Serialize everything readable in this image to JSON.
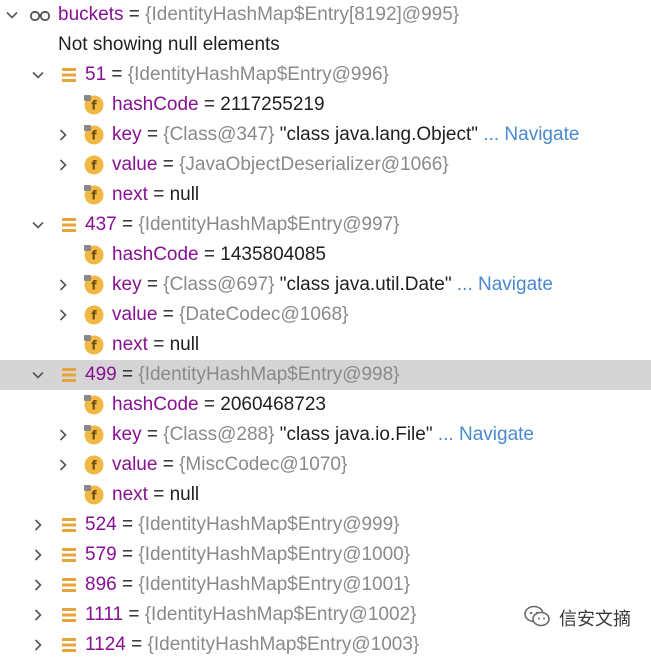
{
  "tree": {
    "root": {
      "name": "buckets",
      "eq": " = ",
      "value": "{IdentityHashMap$Entry[8192]@995}",
      "icon": "glasses-icon"
    },
    "notice": "Not showing null elements",
    "entries": [
      {
        "index": "51",
        "value": "{IdentityHashMap$Entry@996}",
        "fields": [
          {
            "name": "hashCode",
            "plain": "2117255219",
            "gray": "",
            "str": "",
            "nav": ""
          },
          {
            "name": "key",
            "plain": "",
            "gray": "{Class@347}",
            "str": "\"class java.lang.Object\"",
            "nav": "... Navigate"
          },
          {
            "name": "value",
            "plain": "",
            "gray": "{JavaObjectDeserializer@1066}",
            "str": "",
            "nav": ""
          },
          {
            "name": "next",
            "plain": "null",
            "gray": "",
            "str": "",
            "nav": ""
          }
        ]
      },
      {
        "index": "437",
        "value": "{IdentityHashMap$Entry@997}",
        "fields": [
          {
            "name": "hashCode",
            "plain": "1435804085",
            "gray": "",
            "str": "",
            "nav": ""
          },
          {
            "name": "key",
            "plain": "",
            "gray": "{Class@697}",
            "str": "\"class java.util.Date\"",
            "nav": "... Navigate"
          },
          {
            "name": "value",
            "plain": "",
            "gray": "{DateCodec@1068}",
            "str": "",
            "nav": ""
          },
          {
            "name": "next",
            "plain": "null",
            "gray": "",
            "str": "",
            "nav": ""
          }
        ]
      },
      {
        "index": "499",
        "value": "{IdentityHashMap$Entry@998}",
        "fields": [
          {
            "name": "hashCode",
            "plain": "2060468723",
            "gray": "",
            "str": "",
            "nav": ""
          },
          {
            "name": "key",
            "plain": "",
            "gray": "{Class@288}",
            "str": "\"class java.io.File\"",
            "nav": "... Navigate"
          },
          {
            "name": "value",
            "plain": "",
            "gray": "{MiscCodec@1070}",
            "str": "",
            "nav": ""
          },
          {
            "name": "next",
            "plain": "null",
            "gray": "",
            "str": "",
            "nav": ""
          }
        ]
      }
    ],
    "collapsed": [
      {
        "index": "524",
        "value": "{IdentityHashMap$Entry@999}"
      },
      {
        "index": "579",
        "value": "{IdentityHashMap$Entry@1000}"
      },
      {
        "index": "896",
        "value": "{IdentityHashMap$Entry@1001}"
      },
      {
        "index": "1111",
        "value": "{IdentityHashMap$Entry@1002}"
      },
      {
        "index": "1124",
        "value": "{IdentityHashMap$Entry@1003}"
      }
    ],
    "selected_entry_index": "499"
  },
  "watermark": {
    "text": "信安文摘",
    "icon": "wechat-icon"
  },
  "colors": {
    "name": "#871094",
    "gray_value": "#8a8a8a",
    "navigate": "#4a89d0",
    "selection": "#d5d5d5",
    "field_icon": "#f2b844",
    "array_icon": "#e8a33c"
  }
}
